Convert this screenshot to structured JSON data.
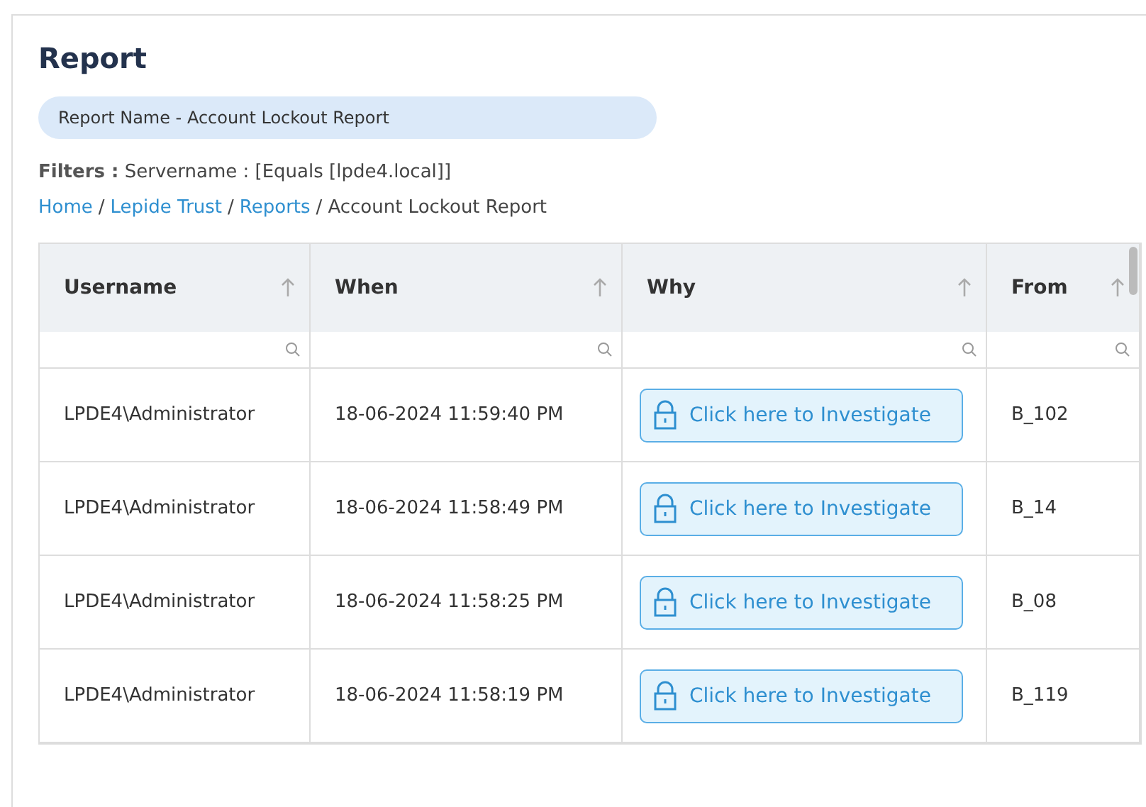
{
  "title": "Report",
  "report_name": "Report Name - Account Lockout Report",
  "filters": {
    "label": "Filters :",
    "value": "Servername : [Equals [lpde4.local]]"
  },
  "breadcrumb_separator": "/",
  "breadcrumb": [
    {
      "label": "Home",
      "kind": "link"
    },
    {
      "label": "Lepide Trust",
      "kind": "link"
    },
    {
      "label": "Reports",
      "kind": "link"
    },
    {
      "label": "Account Lockout Report",
      "kind": "current"
    }
  ],
  "table": {
    "columns": [
      "Username",
      "When",
      "Why",
      "From"
    ],
    "rows": [
      {
        "username": "LPDE4\\Administrator",
        "when": "18-06-2024 11:59:40 PM",
        "why": "Click here to Investigate",
        "from": "B_102"
      },
      {
        "username": "LPDE4\\Administrator",
        "when": "18-06-2024 11:58:49 PM",
        "why": "Click here to Investigate",
        "from": "B_14"
      },
      {
        "username": "LPDE4\\Administrator",
        "when": "18-06-2024 11:58:25 PM",
        "why": "Click here to Investigate",
        "from": "B_08"
      },
      {
        "username": "LPDE4\\Administrator",
        "when": "18-06-2024 11:58:19 PM",
        "why": "Click here to Investigate",
        "from": "B_119"
      }
    ]
  }
}
